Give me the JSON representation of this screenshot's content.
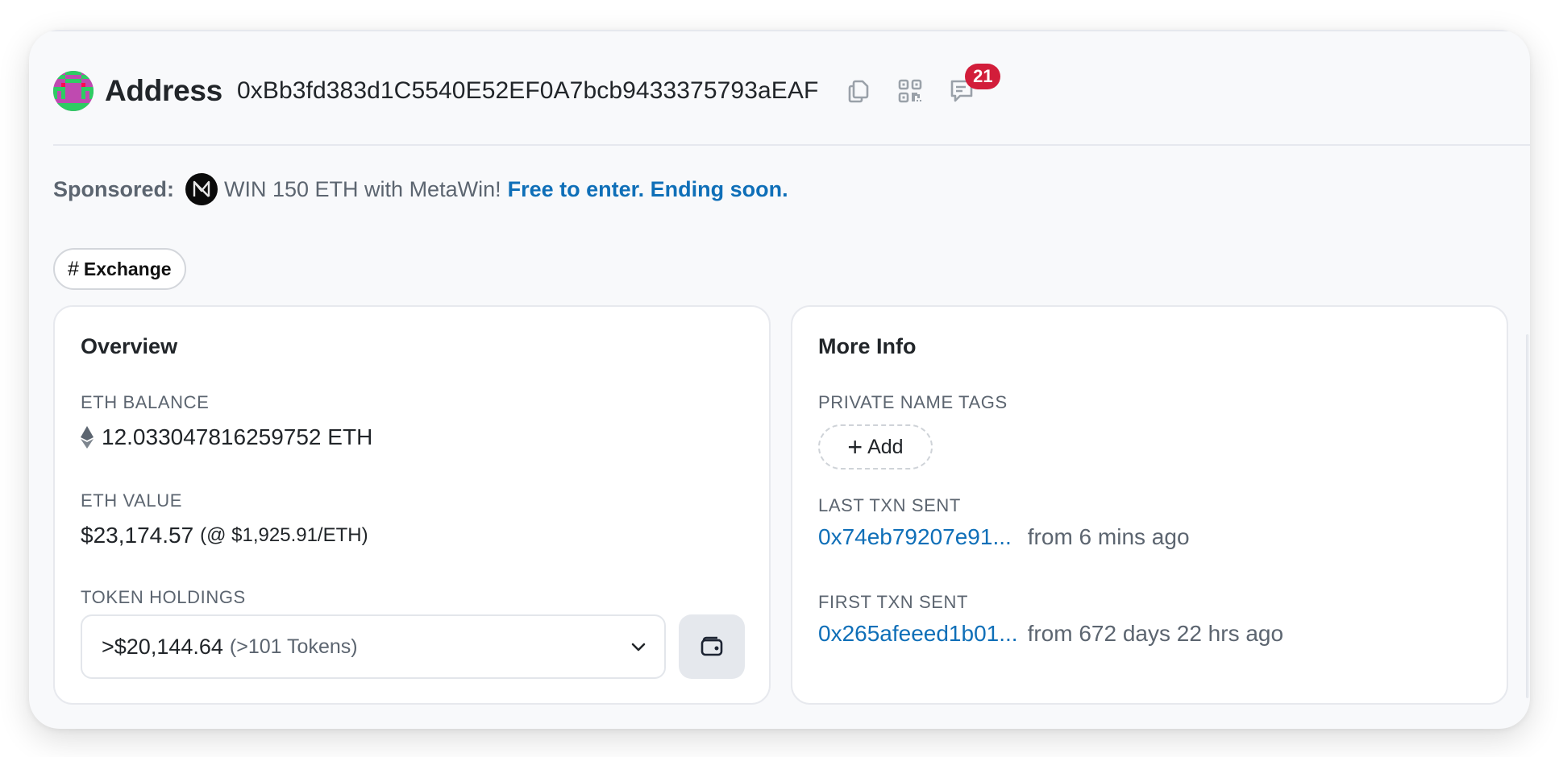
{
  "header": {
    "title": "Address",
    "address": "0xBb3fd383d1C5540E52EF0A7bcb9433375793aEAF",
    "icons": [
      "copy-icon",
      "qr-code-icon",
      "comment-icon"
    ],
    "comment_count": "21"
  },
  "sponsored": {
    "label": "Sponsored:",
    "text": "WIN 150 ETH with MetaWin!",
    "link": "Free to enter. Ending soon."
  },
  "tags": [
    {
      "symbol": "#",
      "label": "Exchange"
    }
  ],
  "overview": {
    "title": "Overview",
    "eth_balance_label": "ETH BALANCE",
    "eth_balance": "12.033047816259752 ETH",
    "eth_value_label": "ETH VALUE",
    "eth_value": "$23,174.57",
    "eth_price": "(@ $1,925.91/ETH)",
    "token_holdings_label": "TOKEN HOLDINGS",
    "token_holdings_amount": ">$20,144.64",
    "token_holdings_count": "(>101 Tokens)"
  },
  "more_info": {
    "title": "More Info",
    "private_tags_label": "PRIVATE NAME TAGS",
    "add_label": "Add",
    "add_symbol": "+",
    "last_txn_label": "LAST TXN SENT",
    "last_txn_hash": "0x74eb79207e91...",
    "last_txn_time": "from 6 mins ago",
    "first_txn_label": "FIRST TXN SENT",
    "first_txn_hash": "0x265afeeed1b01...",
    "first_txn_time": "from 672 days 22 hrs ago"
  },
  "colors": {
    "link": "#0f6fb8",
    "badge": "#d21d3a",
    "muted_text": "#5c6570",
    "background": "#f8f9fb"
  }
}
